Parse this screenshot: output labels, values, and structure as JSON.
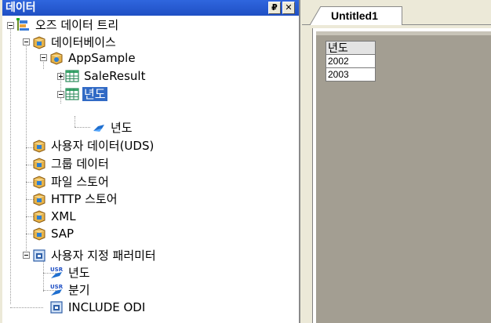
{
  "panel": {
    "title": "데이터",
    "pin_glyph": "₽",
    "close_glyph": "✕"
  },
  "tree": {
    "root": "오즈 데이터 트리",
    "database": "데이터베이스",
    "app_sample": "AppSample",
    "sale_result": "SaleResult",
    "year_set": "년도",
    "year_field": "년도",
    "uds": "사용자 데이터(UDS)",
    "group_data": "그룹 데이터",
    "file_store": "파일 스토어",
    "http_store": "HTTP 스토어",
    "xml": "XML",
    "sap": "SAP",
    "user_params": "사용자 지정 패러미터",
    "param_year": "년도",
    "param_quarter": "분기",
    "include_odi": "INCLUDE ODI"
  },
  "document": {
    "tab_label": "Untitled1",
    "table": {
      "header": "년도",
      "rows": [
        "2002",
        "2003"
      ]
    }
  },
  "colors": {
    "title_bar": "#2f66de",
    "selection": "#316ac5",
    "canvas": "#a39e92"
  }
}
